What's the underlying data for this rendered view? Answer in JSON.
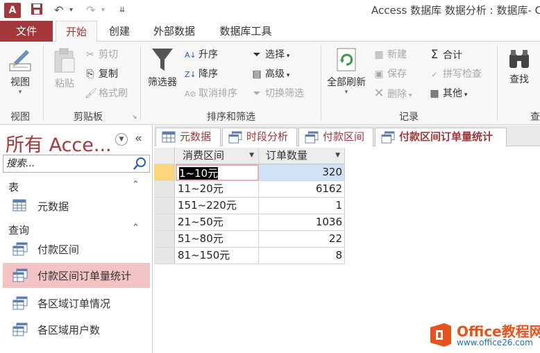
{
  "window": {
    "title": "Access 数据库 数据分析 : 数据库- C",
    "app_icon": "A"
  },
  "qat": {
    "save": "save-icon",
    "undo": "undo-icon",
    "redo": "redo-icon",
    "customize": "customize-icon"
  },
  "ribbon_tabs": {
    "file": "文件",
    "home": "开始",
    "create": "创建",
    "external": "外部数据",
    "dbtools": "数据库工具"
  },
  "ribbon": {
    "view": {
      "label": "视图",
      "group": "视图"
    },
    "clipboard": {
      "paste": "粘贴",
      "cut": "剪切",
      "copy": "复制",
      "format_painter": "格式刷",
      "group": "剪贴板"
    },
    "sort_filter": {
      "filter": "筛选器",
      "ascending": "升序",
      "descending": "降序",
      "remove_sort": "取消排序",
      "selection": "选择",
      "advanced": "高级",
      "toggle_filter": "切换筛选",
      "group": "排序和筛选"
    },
    "records": {
      "refresh_all": "全部刷新",
      "new": "新建",
      "save": "保存",
      "delete": "删除",
      "totals": "合计",
      "spelling": "拼写检查",
      "more": "其他",
      "group": "记录"
    },
    "find": {
      "label": "查找",
      "group": "查"
    }
  },
  "nav": {
    "title": "所有 Acce...",
    "search_placeholder": "搜索...",
    "sections": [
      {
        "label": "表",
        "items": [
          {
            "label": "元数据",
            "type": "table"
          }
        ]
      },
      {
        "label": "查询",
        "items": [
          {
            "label": "付款区间",
            "type": "query"
          },
          {
            "label": "付款区间订单量统计",
            "type": "query",
            "selected": true
          },
          {
            "label": "各区域订单情况",
            "type": "query"
          },
          {
            "label": "各区域用户数",
            "type": "query"
          }
        ]
      }
    ]
  },
  "doc_tabs": [
    {
      "label": "元数据",
      "type": "table"
    },
    {
      "label": "时段分析",
      "type": "query"
    },
    {
      "label": "付款区间",
      "type": "query"
    },
    {
      "label": "付款区间订单量统计",
      "type": "query",
      "active": true
    }
  ],
  "datasheet": {
    "columns": [
      "消费区间",
      "订单数量"
    ],
    "rows": [
      [
        "1~10元",
        "320"
      ],
      [
        "11~20元",
        "6162"
      ],
      [
        "151~220元",
        "1"
      ],
      [
        "21~50元",
        "1036"
      ],
      [
        "51~80元",
        "22"
      ],
      [
        "81~150元",
        "8"
      ]
    ]
  },
  "watermark": {
    "title": "Office教程网",
    "url": "www.office26.com"
  },
  "colors": {
    "accent": "#a4373a",
    "selected_nav": "#f4c3c3",
    "current_row": "#fbd67a",
    "selected_value": "#cfe2f7"
  }
}
